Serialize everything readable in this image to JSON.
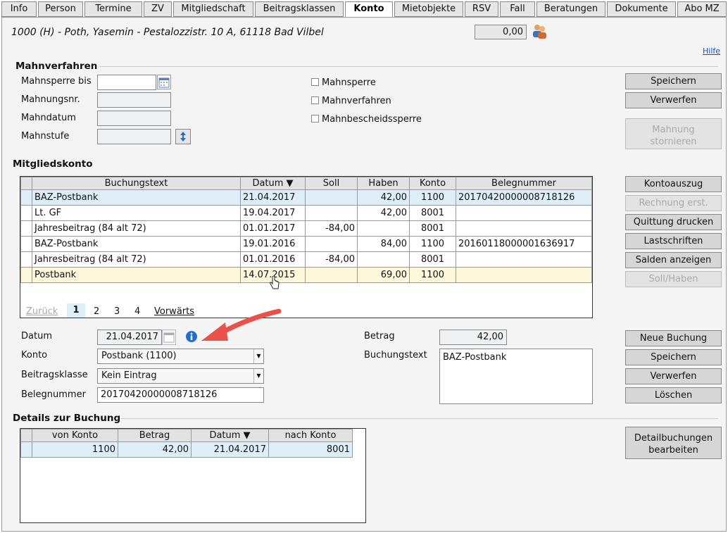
{
  "tabs": [
    "Info",
    "Person",
    "Termine",
    "ZV",
    "Mitgliedschaft",
    "Beitragsklassen",
    "Konto",
    "Mietobjekte",
    "RSV",
    "Fall",
    "Beratungen",
    "Dokumente",
    "Abo MZ"
  ],
  "header": {
    "title": "1000 (H) -  Poth, Yasemin - Pestalozzistr. 10 A, 61118 Bad Vilbel",
    "balance": "0,00",
    "help": "Hilfe"
  },
  "mahnverfahren": {
    "section": "Mahnverfahren",
    "labels": [
      "Mahnsperre bis",
      "Mahnungsnr.",
      "Mahndatum",
      "Mahnstufe"
    ],
    "checkboxes": [
      "Mahnsperre",
      "Mahnverfahren",
      "Mahnbescheidssperre"
    ],
    "buttons": [
      "Speichern",
      "Verwerfen",
      "Mahnung stornieren"
    ]
  },
  "mitgliedskonto": {
    "section": "Mitgliedskonto",
    "columns": [
      "Buchungstext",
      "Datum ▼",
      "Soll",
      "Haben",
      "Konto",
      "Belegnummer"
    ],
    "rows": [
      {
        "text": "BAZ-Postbank",
        "datum": "21.04.2017",
        "soll": "",
        "haben": "42,00",
        "konto": "1100",
        "beleg": "20170420000008718126"
      },
      {
        "text": "Lt. GF",
        "datum": "19.04.2017",
        "soll": "",
        "haben": "42,00",
        "konto": "8001",
        "beleg": ""
      },
      {
        "text": "Jahresbeitrag (84 alt 72)",
        "datum": "01.01.2017",
        "soll": "-84,00",
        "haben": "",
        "konto": "8001",
        "beleg": ""
      },
      {
        "text": "BAZ-Postbank",
        "datum": "19.01.2016",
        "soll": "",
        "haben": "84,00",
        "konto": "1100",
        "beleg": "20160118000001636917"
      },
      {
        "text": "Jahresbeitrag (84 alt 72)",
        "datum": "01.01.2016",
        "soll": "-84,00",
        "haben": "",
        "konto": "8001",
        "beleg": ""
      },
      {
        "text": "Postbank",
        "datum": "14.07.2015",
        "soll": "",
        "haben": "69,00",
        "konto": "1100",
        "beleg": ""
      }
    ],
    "pager": {
      "back": "Zurück",
      "pages": [
        "1",
        "2",
        "3",
        "4"
      ],
      "forward": "Vorwärts"
    },
    "buttons": [
      "Kontoauszug",
      "Rechnung erst.",
      "Quittung drucken",
      "Lastschriften",
      "Salden anzeigen",
      "Soll/Haben"
    ]
  },
  "buchung": {
    "labels": {
      "datum": "Datum",
      "konto": "Konto",
      "beitragsklasse": "Beitragsklasse",
      "belegnummer": "Belegnummer",
      "betrag": "Betrag",
      "buchungstext": "Buchungstext"
    },
    "values": {
      "datum": "21.04.2017",
      "konto": "Postbank (1100)",
      "beitragsklasse": "Kein Eintrag",
      "belegnummer": "20170420000008718126",
      "betrag": "42,00",
      "buchungstext": "BAZ-Postbank"
    },
    "buttons": [
      "Neue Buchung",
      "Speichern",
      "Verwerfen",
      "Löschen"
    ]
  },
  "details": {
    "section": "Details zur Buchung",
    "columns": [
      "von Konto",
      "Betrag",
      "Datum ▼",
      "nach Konto"
    ],
    "rows": [
      {
        "von": "1100",
        "betrag": "42,00",
        "datum": "21.04.2017",
        "nach": "8001"
      }
    ],
    "button": "Detailbuchungen bearbeiten"
  },
  "colors": {
    "accent": "#e8524a",
    "selected_row": "#ddeef9",
    "highlight_row": "#fdf7dc",
    "info": "#1f6fd1"
  }
}
